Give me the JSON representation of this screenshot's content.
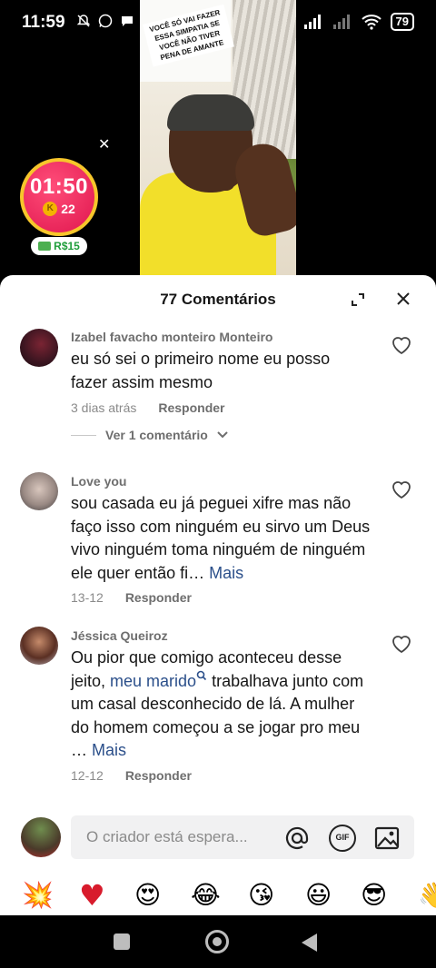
{
  "status_bar": {
    "time": "11:59",
    "battery": "79"
  },
  "video": {
    "caption": "VOCÊ SÓ VAI FAZER ESSA SIMPATIA SE VOCÊ NÃO TIVER PENA DE AMANTE"
  },
  "timer_widget": {
    "time": "01:50",
    "coin_icon": "K",
    "coins": "22",
    "reward": "R$15"
  },
  "sheet": {
    "title": "77 Comentários"
  },
  "comments": [
    {
      "user": "Izabel favacho monteiro Monteiro",
      "text": "eu só sei o primeiro nome eu posso fazer assim mesmo",
      "date": "3 dias atrás",
      "reply_label": "Responder",
      "view_replies": "Ver 1 comentário"
    },
    {
      "user": "Love you",
      "text": "sou casada eu já peguei  xifre mas não faço  isso  com ninguém  eu sirvo um Deus vivo  ninguém  toma ninguém  de ninguém  ele quer então  fi…",
      "more": "Mais",
      "date": "13-12",
      "reply_label": "Responder"
    },
    {
      "user": "Jéssica Queiroz",
      "text_before": "Ou pior que comigo aconteceu desse jeito, ",
      "mention": "meu marido",
      "text_after": " trabalhava junto com um casal desconhecido de lá. A mulher do homem começou a se jogar pro meu …",
      "more": "Mais",
      "date": "12-12",
      "reply_label": "Responder"
    }
  ],
  "input": {
    "placeholder": "O criador está espera...",
    "gif_label": "GIF"
  },
  "emoji_bar": [
    "💥",
    "♥",
    "😍",
    "😂",
    "😘",
    "😃",
    "😎",
    "👋"
  ],
  "colors": {
    "timer": "#e0164e",
    "timer_ring": "#f7c62b",
    "link": "#2b4f8a",
    "money": "#1f9d3a"
  }
}
